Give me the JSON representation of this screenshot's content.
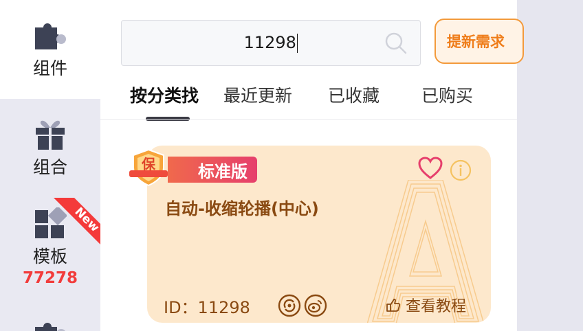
{
  "sidebar": {
    "items": [
      {
        "label": "组件",
        "icon": "puzzle-icon"
      },
      {
        "label": "组合",
        "icon": "gift-icon"
      },
      {
        "label": "模板",
        "icon": "template-grid-icon",
        "count": "77278",
        "ribbon": "New"
      },
      {
        "label": "",
        "icon": "puzzle-icon"
      }
    ]
  },
  "search": {
    "value": "11298",
    "icon": "search-icon"
  },
  "header": {
    "request_button": "提新需求"
  },
  "tabs": [
    {
      "label": "按分类找",
      "active": true
    },
    {
      "label": "最近更新",
      "active": false
    },
    {
      "label": "已收藏",
      "active": false
    },
    {
      "label": "已购买",
      "active": false
    }
  ],
  "card": {
    "badge": "标准版",
    "shield_text": "保",
    "title": "自动-收缩轮播(中心)",
    "id_text": "ID：11298",
    "tutorial": "查看教程",
    "watermark_letter": "A",
    "icons": [
      "heart-icon",
      "info-icon",
      "share-icon",
      "weibo-icon",
      "hand-pointer-icon"
    ]
  },
  "colors": {
    "accent_orange": "#ef7d1a",
    "card_bg": "#fde8cc",
    "card_text": "#8a4a12",
    "badge_red": "#e63f6c",
    "count_red": "#f23c3c",
    "ribbon_red": "#f43a3a"
  }
}
